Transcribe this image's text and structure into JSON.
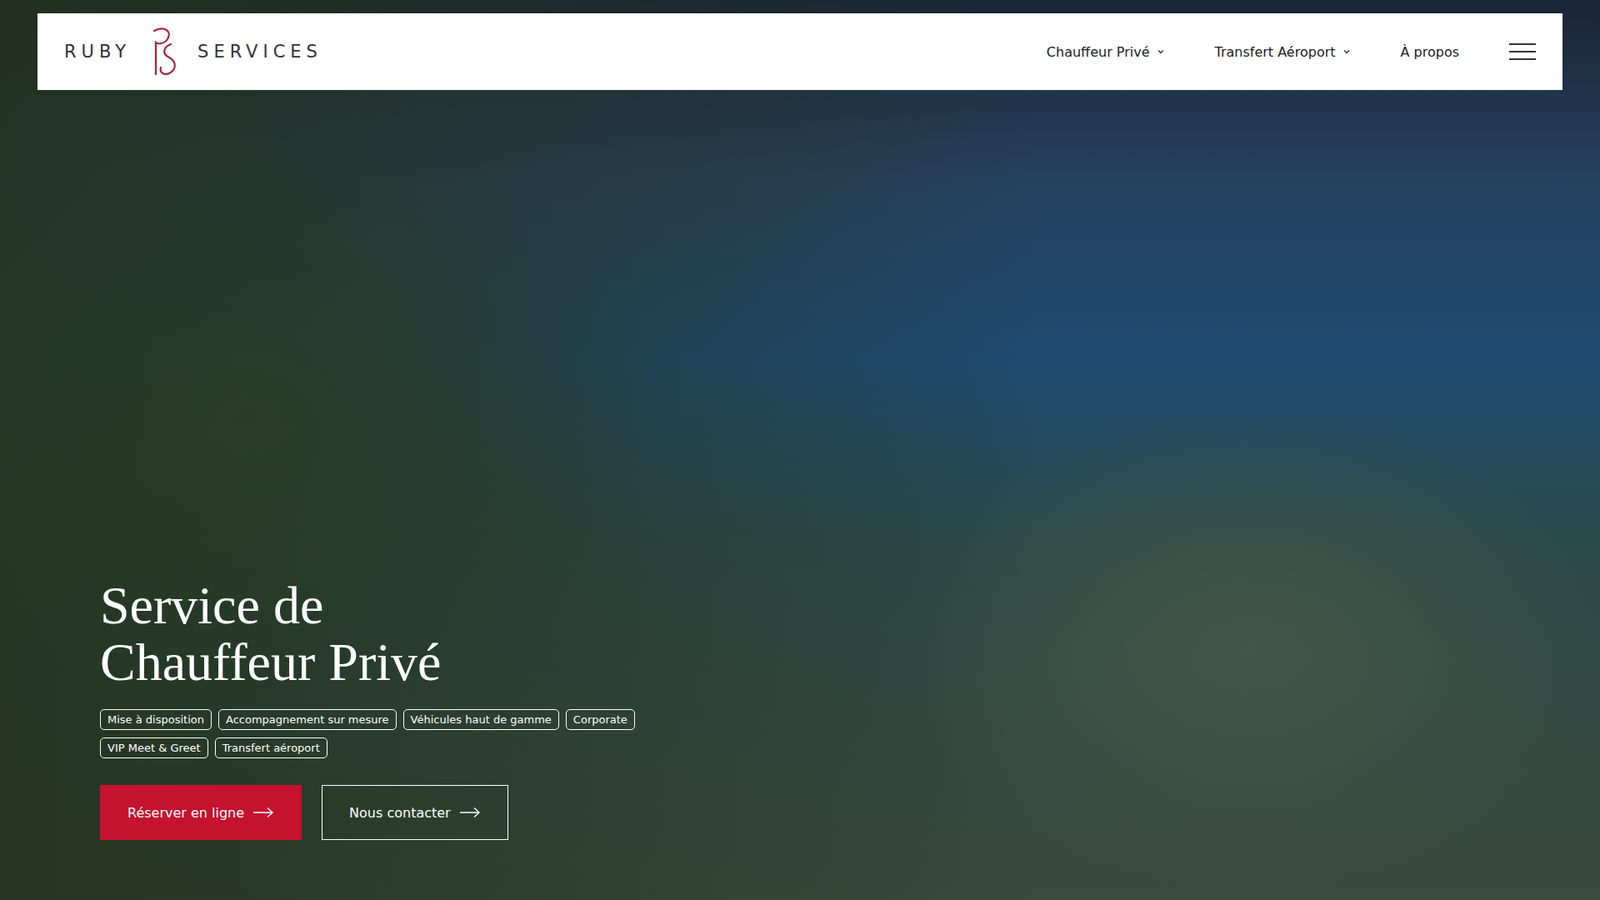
{
  "logo": {
    "left": "RUBY",
    "right": "SERVICES"
  },
  "nav": [
    {
      "label": "Chauffeur Privé",
      "dropdown": true
    },
    {
      "label": "Transfert Aéroport",
      "dropdown": true
    },
    {
      "label": "À propos",
      "dropdown": false
    }
  ],
  "hero": {
    "title_lines": [
      "Service de",
      "Chauffeur Privé"
    ],
    "tag_rows": [
      [
        "Mise à disposition",
        "Accompagnement sur mesure",
        "Véhicules haut de gamme",
        "Corporate"
      ],
      [
        "VIP Meet & Greet",
        "Transfert aéroport"
      ]
    ],
    "buttons": [
      {
        "label": "Réserver en ligne",
        "kind": "primary"
      },
      {
        "label": "Nous contacter",
        "kind": "outline"
      }
    ]
  }
}
